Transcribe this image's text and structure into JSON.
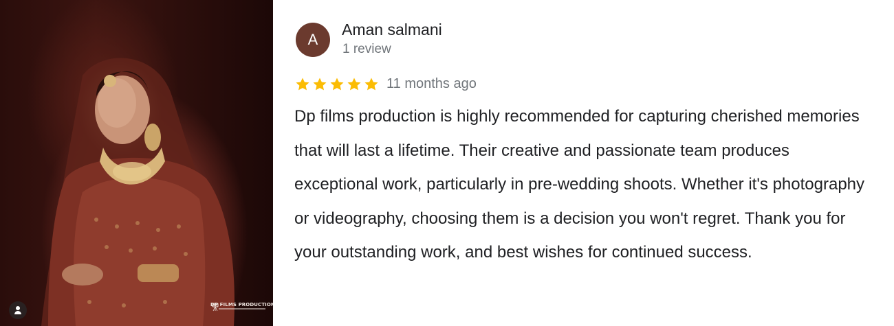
{
  "photo": {
    "alt_subject": "bride-portrait",
    "watermark_text": "DP FILMS PRODUCTION",
    "colors": {
      "background": "#2a0d0b",
      "outfit": "#8e3a2c",
      "gold": "#d8b57a"
    }
  },
  "reviewer": {
    "avatar_initial": "A",
    "name": "Aman salmani",
    "review_count": "1 review",
    "avatar_color": "#6b3a2e"
  },
  "review": {
    "rating": 5,
    "max_rating": 5,
    "star_color": "#fbbc04",
    "date": "11 months ago",
    "text": "Dp films production is highly recommended for capturing cherished memories that will last a lifetime. Their creative and passionate team produces exceptional work, particularly in pre-wedding shoots. Whether it's photography or videography, choosing them is a decision you won't regret. Thank you for your outstanding work, and best wishes for continued success."
  },
  "icons": {
    "user_tag": "user-tag-icon",
    "camera": "camera-tripod-icon",
    "star": "star-icon"
  }
}
